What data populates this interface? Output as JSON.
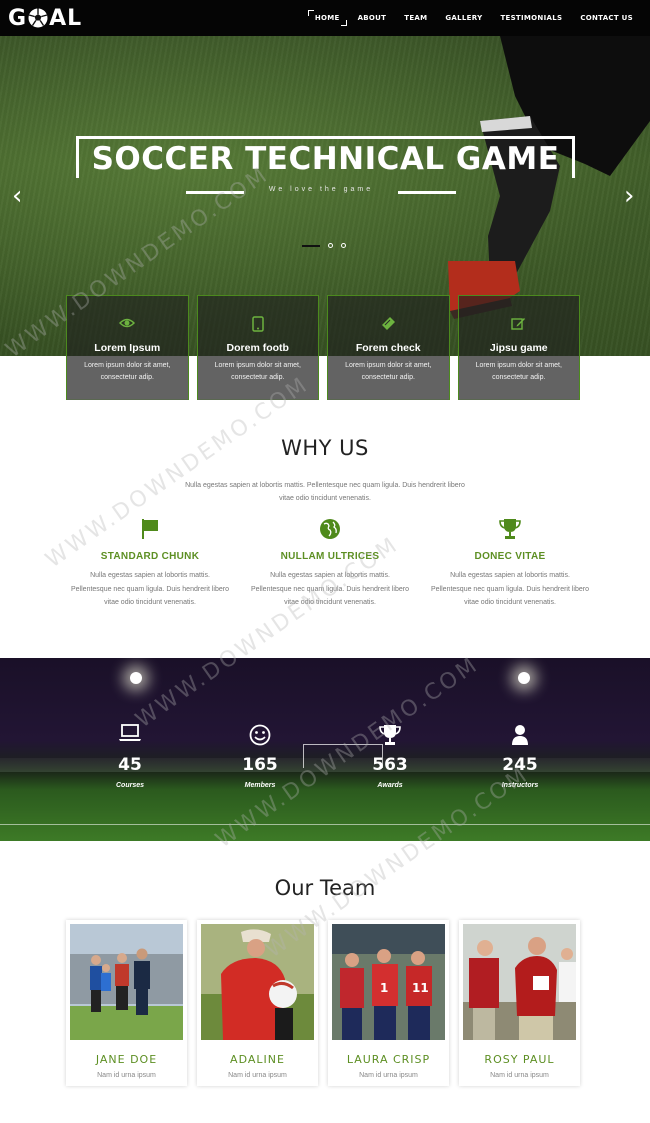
{
  "nav": {
    "logo": "GOAL",
    "items": [
      "HOME",
      "ABOUT",
      "TEAM",
      "GALLERY",
      "TESTIMONIALS",
      "CONTACT US"
    ]
  },
  "hero": {
    "title": "SOCCER TECHNICAL GAME",
    "subtitle": "We love the game",
    "prev": "‹",
    "next": "›"
  },
  "features": [
    {
      "icon": "eye-icon",
      "title": "Lorem Ipsum",
      "text": "Lorem ipsum dolor sit amet, consectetur adip."
    },
    {
      "icon": "tablet-icon",
      "title": "Dorem footb",
      "text": "Lorem ipsum dolor sit amet, consectetur adip."
    },
    {
      "icon": "ticket-icon",
      "title": "Forem check",
      "text": "Lorem ipsum dolor sit amet, consectetur adip."
    },
    {
      "icon": "edit-icon",
      "title": "Jipsu game",
      "text": "Lorem ipsum dolor sit amet, consectetur adip."
    }
  ],
  "why": {
    "title": "WHY US",
    "desc": "Nulla egestas sapien at lobortis mattis. Pellentesque nec quam ligula. Duis hendrerit libero vitae odio tincidunt venenatis.",
    "cols": [
      {
        "icon": "flag-icon",
        "title": "STANDARD CHUNK",
        "text": "Nulla egestas sapien at lobortis mattis. Pellentesque nec quam ligula. Duis hendrerit libero vitae odio tincidunt venenatis."
      },
      {
        "icon": "globe-icon",
        "title": "NULLAM ULTRICES",
        "text": "Nulla egestas sapien at lobortis mattis. Pellentesque nec quam ligula. Duis hendrerit libero vitae odio tincidunt venenatis."
      },
      {
        "icon": "trophy-icon",
        "title": "DONEC VITAE",
        "text": "Nulla egestas sapien at lobortis mattis. Pellentesque nec quam ligula. Duis hendrerit libero vitae odio tincidunt venenatis."
      }
    ]
  },
  "stats": [
    {
      "icon": "laptop-icon",
      "value": "45",
      "label": "Courses"
    },
    {
      "icon": "smile-icon",
      "value": "165",
      "label": "Members"
    },
    {
      "icon": "trophy-icon",
      "value": "563",
      "label": "Awards"
    },
    {
      "icon": "user-icon",
      "value": "245",
      "label": "Instructors"
    }
  ],
  "team": {
    "title": "Our Team",
    "members": [
      {
        "name": "JANE DOE",
        "role": "Nam id urna ipsum"
      },
      {
        "name": "ADALINE",
        "role": "Nam id urna ipsum"
      },
      {
        "name": "LAURA CRISP",
        "role": "Nam id urna ipsum"
      },
      {
        "name": "ROSY PAUL",
        "role": "Nam id urna ipsum"
      }
    ]
  },
  "watermark": "WWW.DOWNDEMO.COM",
  "colors": {
    "accent": "#5d8f23",
    "nav": "#050505"
  }
}
